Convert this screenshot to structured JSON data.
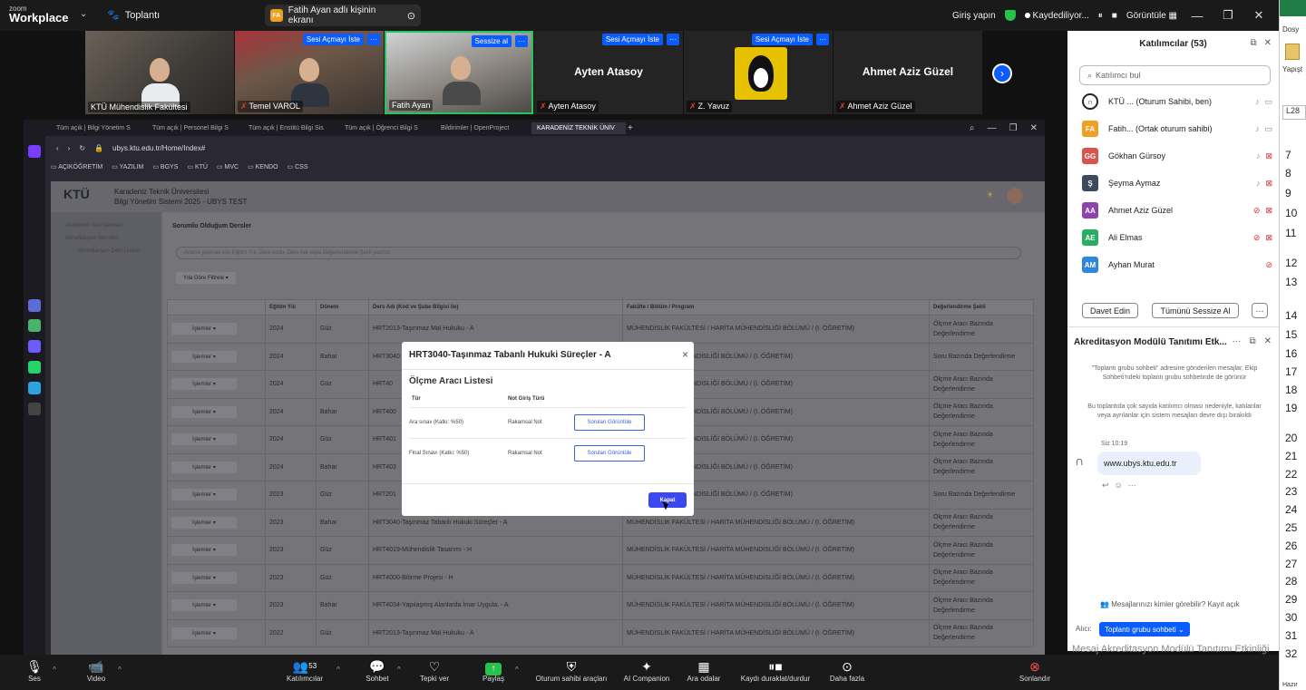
{
  "zoom": {
    "logo_small": "zoom",
    "logo_big": "Workplace",
    "meeting_label": "Toplantı",
    "share_badge": "FA",
    "share_label": "Fatih Ayan adlı kişinin ekranı",
    "signin": "Giriş yapın",
    "recording": "Kaydediliyor...",
    "view": "Görüntüle",
    "accent": "#0b5cff"
  },
  "participants_strip": [
    {
      "name": "KTÜ Mühendislik Fakültesi",
      "video": true
    },
    {
      "name": "Temel VAROL",
      "video": true,
      "muted": true,
      "request": "Sesi Açmayı İste"
    },
    {
      "name": "Fatih Ayan",
      "video": true,
      "request": "Sessize al"
    },
    {
      "name": "Ayten Atasoy",
      "display": "Ayten Atasoy",
      "muted": true,
      "request": "Sesi Açmayı İste"
    },
    {
      "name": "Z. Yavuz",
      "muted": true,
      "request": "Sesi Açmayı İste",
      "avatar": "tux-icon"
    },
    {
      "name": "Ahmet Aziz Güzel",
      "display": "Ahmet Aziz Güzel",
      "muted": true
    }
  ],
  "browser": {
    "tabs": [
      "Tüm açık | Bilgi Yönetim S",
      "Tüm açık | Personel Bilgi S",
      "Tüm açık | Enstitü Bilgi Sis",
      "Tüm açık | Öğrenci Bilgi S",
      "Bildirimler | OpenProject",
      "KARADENİZ TEKNİK ÜNİV"
    ],
    "url": "ubys.ktu.edu.tr/Home/Index#",
    "bookmarks": [
      "AÇIKÖĞRETİM",
      "YAZILIM",
      "BGYS",
      "KTÜ",
      "MVC",
      "KENDO",
      "CSS"
    ]
  },
  "ubys": {
    "logo": "KTÜ",
    "title": "Karadeniz Teknik Üniversitesi",
    "subtitle": "Bilgi Yönetim Sistemi 2025 - UBYS TEST",
    "side_items": [
      "Akademik Geri İşlemleri",
      "Akreditasyon İşlemleri",
      "Akreditasyon Ders Listesi"
    ],
    "section_title": "Sorumlu Olduğum Dersler",
    "search_placeholder": "Arama yapmak için Eğitim Yılı, Ders kodu, Ders Adı veya Değerlendirme Şekli yazınız",
    "filter_label": "Yıla Göre Filtrele ▾",
    "columns": [
      "",
      "Eğitim Yılı",
      "Dönem",
      "Ders Adı (Kod ve Şube Bilgisi ile)",
      "Fakülte / Bölüm / Program",
      "Değerlendirme Şekli"
    ],
    "action_label": "İşlemler ▾",
    "rows": [
      {
        "year": "2024",
        "term": "Güz",
        "course": "HRT2013-Taşınmaz Mal Hukuku - A",
        "program": "MÜHENDİSLİK FAKÜLTESİ / HARİTA MÜHENDİSLİĞİ BÖLÜMÜ / (I. ÖĞRETİM)",
        "eval": "Ölçme Aracı Bazında Değerlendirme"
      },
      {
        "year": "2024",
        "term": "Bahar",
        "course": "HRT3040",
        "program": "LTESİ / HARİTA MÜHENDİSLİĞİ BÖLÜMÜ / (I. ÖĞRETİM)",
        "eval": "Soru Bazında Değerlendirme"
      },
      {
        "year": "2024",
        "term": "Güz",
        "course": "HRT40",
        "program": "LTESİ / HARİTA MÜHENDİSLİĞİ BÖLÜMÜ / (I. ÖĞRETİM)",
        "eval": "Ölçme Aracı Bazında Değerlendirme"
      },
      {
        "year": "2024",
        "term": "Bahar",
        "course": "HRT400",
        "program": "LTESİ / HARİTA MÜHENDİSLİĞİ BÖLÜMÜ / (I. ÖĞRETİM)",
        "eval": "Ölçme Aracı Bazında Değerlendirme"
      },
      {
        "year": "2024",
        "term": "Güz",
        "course": "HRT401",
        "program": "LTESİ / HARİTA MÜHENDİSLİĞİ BÖLÜMÜ / (I. ÖĞRETİM)",
        "eval": "Ölçme Aracı Bazında Değerlendirme"
      },
      {
        "year": "2024",
        "term": "Bahar",
        "course": "HRT403",
        "program": "LTESİ / HARİTA MÜHENDİSLİĞİ BÖLÜMÜ / (I. ÖĞRETİM)",
        "eval": "Ölçme Aracı Bazında Değerlendirme"
      },
      {
        "year": "2023",
        "term": "Güz",
        "course": "HRT201",
        "program": "LTESİ / HARİTA MÜHENDİSLİĞİ BÖLÜMÜ / (I. ÖĞRETİM)",
        "eval": "Soru Bazında Değerlendirme"
      },
      {
        "year": "2023",
        "term": "Bahar",
        "course": "HRT3040-Taşınmaz Tabanlı Hukuki Süreçler - A",
        "program": "MÜHENDİSLİK FAKÜLTESİ / HARİTA MÜHENDİSLİĞİ BÖLÜMÜ / (I. ÖĞRETİM)",
        "eval": "Ölçme Aracı Bazında Değerlendirme"
      },
      {
        "year": "2023",
        "term": "Güz",
        "course": "HRT4019-Mühendislik Tasarımı - H",
        "program": "MÜHENDİSLİK FAKÜLTESİ / HARİTA MÜHENDİSLİĞİ BÖLÜMÜ / (I. ÖĞRETİM)",
        "eval": "Ölçme Aracı Bazında Değerlendirme"
      },
      {
        "year": "2023",
        "term": "Güz",
        "course": "HRT4000-Bitirme Projesi - H",
        "program": "MÜHENDİSLİK FAKÜLTESİ / HARİTA MÜHENDİSLİĞİ BÖLÜMÜ / (I. ÖĞRETİM)",
        "eval": "Ölçme Aracı Bazında Değerlendirme"
      },
      {
        "year": "2023",
        "term": "Bahar",
        "course": "HRT4034-Yapılaşmış Alanlarda İmar Uygula. - A",
        "program": "MÜHENDİSLİK FAKÜLTESİ / HARİTA MÜHENDİSLİĞİ BÖLÜMÜ / (I. ÖĞRETİM)",
        "eval": "Ölçme Aracı Bazında Değerlendirme"
      },
      {
        "year": "2022",
        "term": "Güz",
        "course": "HRT2013-Taşınmaz Mal Hukuku - A",
        "program": "MÜHENDİSLİK FAKÜLTESİ / HARİTA MÜHENDİSLİĞİ BÖLÜMÜ / (I. ÖĞRETİM)",
        "eval": "Ölçme Aracı Bazında Değerlendirme"
      }
    ]
  },
  "modal": {
    "title": "HRT3040-Taşınmaz Tabanlı Hukuki Süreçler - A",
    "subtitle": "Ölçme Aracı Listesi",
    "col_tur": "Tür",
    "col_not": "Not Giriş Türü",
    "rows": [
      {
        "tur": "Ara sınav (Katkı: %50)",
        "not": "Rakamsal Not",
        "btn": "Soruları Görüntüle"
      },
      {
        "tur": "Final Sınavı (Katkı: %50)",
        "not": "Rakamsal Not",
        "btn": "Soruları Görüntüle"
      }
    ],
    "close_label": "Kapat"
  },
  "participants_panel": {
    "title": "Katılımcılar (53)",
    "find_placeholder": "Katılımcı bul",
    "list": [
      {
        "initials": "",
        "name": "KTÜ ... (Oturum Sahibi, ben)",
        "color": "#ffffff",
        "mic": "on",
        "cam": "on",
        "logo": true
      },
      {
        "initials": "FA",
        "name": "Fatih... (Ortak oturum sahibi)",
        "color": "#f0a020",
        "mic": "on",
        "cam": "on"
      },
      {
        "initials": "GG",
        "name": "Gökhan Gürsoy",
        "color": "#d9534f",
        "mic": "on",
        "cam": "off"
      },
      {
        "initials": "Ş",
        "name": "Şeyma Aymaz",
        "color": "#3d4a5c",
        "mic": "on",
        "cam": "off"
      },
      {
        "initials": "AA",
        "name": "Ahmet Aziz Güzel",
        "color": "#8e44ad",
        "mic": "off",
        "cam": "off"
      },
      {
        "initials": "AE",
        "name": "Ali Elmas",
        "color": "#27ae60",
        "mic": "off",
        "cam": "off"
      },
      {
        "initials": "AM",
        "name": "Ayhan Murat",
        "color": "#2e86de",
        "mic": "off",
        "cam": "none"
      }
    ],
    "invite_label": "Davet Edin",
    "mute_all_label": "Tümünü Sessize Al",
    "more_label": "···"
  },
  "chat_panel": {
    "title": "Akreditasyon Modülü Tanıtımı Etk...",
    "note1": "\"Toplantı grubu sohbeti\" adresine gönderilen mesajlar, Ekip Sohbeti'ndeki toplantı grubu sohbetinde de görünür",
    "note2": "Bu toplantıda çok sayıda katılımcı olması nedeniyle, katılanlar veya ayrılanlar için sistem mesajları devre dışı bırakıldı",
    "time": "Siz 10:19",
    "message": "www.ubys.ktu.edu.tr",
    "who_sees": "Mesajlarınızı kimler görebilir? Kayıt açık",
    "to_label": "Alıcı:",
    "to_value": "Toplantı grubu sohbeti ⌄",
    "input_placeholder": "Mesaj Akreditasyon Modülü Tanıtımı Etkinliği"
  },
  "sheet": {
    "label_top": "Dosy",
    "label_paste": "Yapışt",
    "cell": "L28",
    "rows": [
      "7",
      "8",
      "9",
      "10",
      "11",
      "12",
      "13",
      "14",
      "15",
      "16",
      "17",
      "18",
      "19",
      "20",
      "21",
      "22",
      "23",
      "24",
      "25",
      "26",
      "27",
      "28",
      "29",
      "30",
      "31",
      "32"
    ],
    "status": "Hazır"
  },
  "toolbar": {
    "audio": "Ses",
    "video": "Video",
    "participants": "Katılımcılar",
    "participants_count": "53",
    "chat": "Sohbet",
    "react": "Tepki ver",
    "share": "Paylaş",
    "host_tools": "Oturum sahibi araçları",
    "ai": "AI Companion",
    "breakout": "Ara odalar",
    "record": "Kaydı duraklat/durdur",
    "more": "Daha fazla",
    "end": "Sonlandır"
  }
}
